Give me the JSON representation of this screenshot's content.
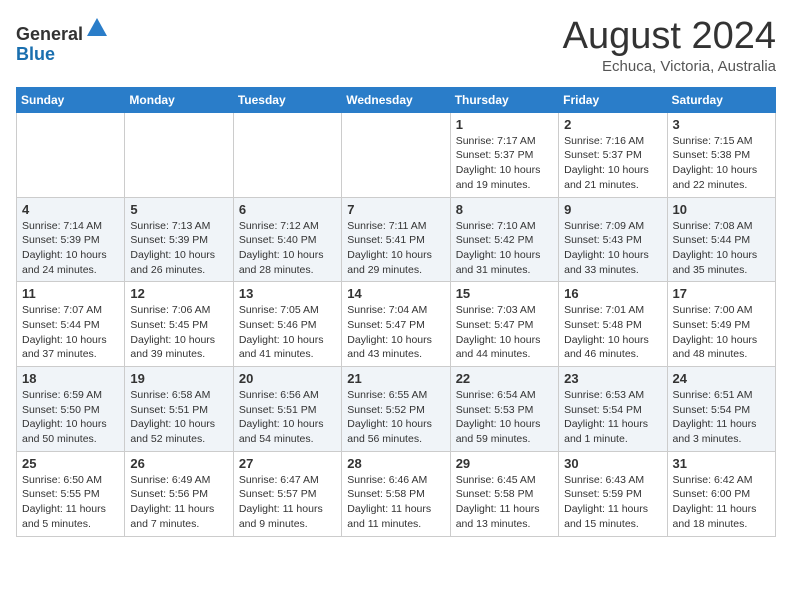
{
  "logo": {
    "general": "General",
    "blue": "Blue"
  },
  "title": {
    "month_year": "August 2024",
    "location": "Echuca, Victoria, Australia"
  },
  "headers": [
    "Sunday",
    "Monday",
    "Tuesday",
    "Wednesday",
    "Thursday",
    "Friday",
    "Saturday"
  ],
  "rows": [
    [
      {
        "day": "",
        "info": ""
      },
      {
        "day": "",
        "info": ""
      },
      {
        "day": "",
        "info": ""
      },
      {
        "day": "",
        "info": ""
      },
      {
        "day": "1",
        "info": "Sunrise: 7:17 AM\nSunset: 5:37 PM\nDaylight: 10 hours\nand 19 minutes."
      },
      {
        "day": "2",
        "info": "Sunrise: 7:16 AM\nSunset: 5:37 PM\nDaylight: 10 hours\nand 21 minutes."
      },
      {
        "day": "3",
        "info": "Sunrise: 7:15 AM\nSunset: 5:38 PM\nDaylight: 10 hours\nand 22 minutes."
      }
    ],
    [
      {
        "day": "4",
        "info": "Sunrise: 7:14 AM\nSunset: 5:39 PM\nDaylight: 10 hours\nand 24 minutes."
      },
      {
        "day": "5",
        "info": "Sunrise: 7:13 AM\nSunset: 5:39 PM\nDaylight: 10 hours\nand 26 minutes."
      },
      {
        "day": "6",
        "info": "Sunrise: 7:12 AM\nSunset: 5:40 PM\nDaylight: 10 hours\nand 28 minutes."
      },
      {
        "day": "7",
        "info": "Sunrise: 7:11 AM\nSunset: 5:41 PM\nDaylight: 10 hours\nand 29 minutes."
      },
      {
        "day": "8",
        "info": "Sunrise: 7:10 AM\nSunset: 5:42 PM\nDaylight: 10 hours\nand 31 minutes."
      },
      {
        "day": "9",
        "info": "Sunrise: 7:09 AM\nSunset: 5:43 PM\nDaylight: 10 hours\nand 33 minutes."
      },
      {
        "day": "10",
        "info": "Sunrise: 7:08 AM\nSunset: 5:44 PM\nDaylight: 10 hours\nand 35 minutes."
      }
    ],
    [
      {
        "day": "11",
        "info": "Sunrise: 7:07 AM\nSunset: 5:44 PM\nDaylight: 10 hours\nand 37 minutes."
      },
      {
        "day": "12",
        "info": "Sunrise: 7:06 AM\nSunset: 5:45 PM\nDaylight: 10 hours\nand 39 minutes."
      },
      {
        "day": "13",
        "info": "Sunrise: 7:05 AM\nSunset: 5:46 PM\nDaylight: 10 hours\nand 41 minutes."
      },
      {
        "day": "14",
        "info": "Sunrise: 7:04 AM\nSunset: 5:47 PM\nDaylight: 10 hours\nand 43 minutes."
      },
      {
        "day": "15",
        "info": "Sunrise: 7:03 AM\nSunset: 5:47 PM\nDaylight: 10 hours\nand 44 minutes."
      },
      {
        "day": "16",
        "info": "Sunrise: 7:01 AM\nSunset: 5:48 PM\nDaylight: 10 hours\nand 46 minutes."
      },
      {
        "day": "17",
        "info": "Sunrise: 7:00 AM\nSunset: 5:49 PM\nDaylight: 10 hours\nand 48 minutes."
      }
    ],
    [
      {
        "day": "18",
        "info": "Sunrise: 6:59 AM\nSunset: 5:50 PM\nDaylight: 10 hours\nand 50 minutes."
      },
      {
        "day": "19",
        "info": "Sunrise: 6:58 AM\nSunset: 5:51 PM\nDaylight: 10 hours\nand 52 minutes."
      },
      {
        "day": "20",
        "info": "Sunrise: 6:56 AM\nSunset: 5:51 PM\nDaylight: 10 hours\nand 54 minutes."
      },
      {
        "day": "21",
        "info": "Sunrise: 6:55 AM\nSunset: 5:52 PM\nDaylight: 10 hours\nand 56 minutes."
      },
      {
        "day": "22",
        "info": "Sunrise: 6:54 AM\nSunset: 5:53 PM\nDaylight: 10 hours\nand 59 minutes."
      },
      {
        "day": "23",
        "info": "Sunrise: 6:53 AM\nSunset: 5:54 PM\nDaylight: 11 hours\nand 1 minute."
      },
      {
        "day": "24",
        "info": "Sunrise: 6:51 AM\nSunset: 5:54 PM\nDaylight: 11 hours\nand 3 minutes."
      }
    ],
    [
      {
        "day": "25",
        "info": "Sunrise: 6:50 AM\nSunset: 5:55 PM\nDaylight: 11 hours\nand 5 minutes."
      },
      {
        "day": "26",
        "info": "Sunrise: 6:49 AM\nSunset: 5:56 PM\nDaylight: 11 hours\nand 7 minutes."
      },
      {
        "day": "27",
        "info": "Sunrise: 6:47 AM\nSunset: 5:57 PM\nDaylight: 11 hours\nand 9 minutes."
      },
      {
        "day": "28",
        "info": "Sunrise: 6:46 AM\nSunset: 5:58 PM\nDaylight: 11 hours\nand 11 minutes."
      },
      {
        "day": "29",
        "info": "Sunrise: 6:45 AM\nSunset: 5:58 PM\nDaylight: 11 hours\nand 13 minutes."
      },
      {
        "day": "30",
        "info": "Sunrise: 6:43 AM\nSunset: 5:59 PM\nDaylight: 11 hours\nand 15 minutes."
      },
      {
        "day": "31",
        "info": "Sunrise: 6:42 AM\nSunset: 6:00 PM\nDaylight: 11 hours\nand 18 minutes."
      }
    ]
  ]
}
